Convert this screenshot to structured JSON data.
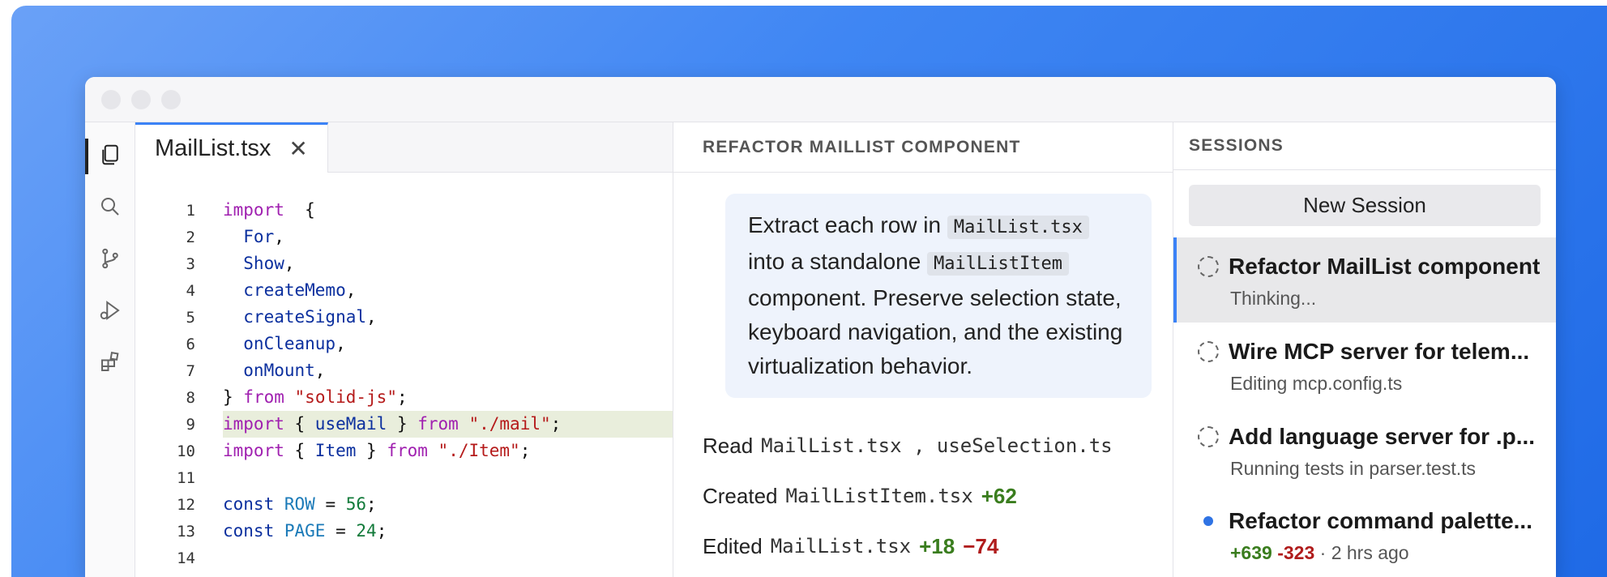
{
  "editor": {
    "tab_label": "MailList.tsx",
    "tab_close": "✕",
    "lines": [
      {
        "n": "1",
        "hl": false,
        "parts": [
          [
            "kw",
            "import"
          ],
          [
            "",
            "  {"
          ]
        ]
      },
      {
        "n": "2",
        "hl": false,
        "parts": [
          [
            "idf",
            "  For"
          ],
          [
            "",
            ","
          ]
        ]
      },
      {
        "n": "3",
        "hl": false,
        "parts": [
          [
            "idf",
            "  Show"
          ],
          [
            "",
            ","
          ]
        ]
      },
      {
        "n": "4",
        "hl": false,
        "parts": [
          [
            "idf",
            "  createMemo"
          ],
          [
            "",
            ","
          ]
        ]
      },
      {
        "n": "5",
        "hl": false,
        "parts": [
          [
            "idf",
            "  createSignal"
          ],
          [
            "",
            ","
          ]
        ]
      },
      {
        "n": "6",
        "hl": false,
        "parts": [
          [
            "idf",
            "  onCleanup"
          ],
          [
            "",
            ","
          ]
        ]
      },
      {
        "n": "7",
        "hl": false,
        "parts": [
          [
            "idf",
            "  onMount"
          ],
          [
            "",
            ","
          ]
        ]
      },
      {
        "n": "8",
        "hl": false,
        "parts": [
          [
            "",
            "} "
          ],
          [
            "kw",
            "from"
          ],
          [
            "",
            " "
          ],
          [
            "str",
            "\"solid-js\""
          ],
          [
            "",
            ";"
          ]
        ]
      },
      {
        "n": "9",
        "hl": true,
        "parts": [
          [
            "kw",
            "import"
          ],
          [
            "",
            " { "
          ],
          [
            "idf",
            "useMail"
          ],
          [
            "",
            " } "
          ],
          [
            "kw",
            "from"
          ],
          [
            "",
            " "
          ],
          [
            "str",
            "\"./mail\""
          ],
          [
            "",
            ";"
          ]
        ]
      },
      {
        "n": "10",
        "hl": false,
        "parts": [
          [
            "kw",
            "import"
          ],
          [
            "",
            " { "
          ],
          [
            "idf",
            "Item"
          ],
          [
            "",
            " } "
          ],
          [
            "kw",
            "from"
          ],
          [
            "",
            " "
          ],
          [
            "str",
            "\"./Item\""
          ],
          [
            "",
            ";"
          ]
        ]
      },
      {
        "n": "11",
        "hl": false,
        "parts": []
      },
      {
        "n": "12",
        "hl": false,
        "parts": [
          [
            "idf",
            "const"
          ],
          [
            "",
            " "
          ],
          [
            "cst",
            "ROW"
          ],
          [
            "",
            " = "
          ],
          [
            "num",
            "56"
          ],
          [
            "",
            ";"
          ]
        ]
      },
      {
        "n": "13",
        "hl": false,
        "parts": [
          [
            "idf",
            "const"
          ],
          [
            "",
            " "
          ],
          [
            "cst",
            "PAGE"
          ],
          [
            "",
            " = "
          ],
          [
            "num",
            "24"
          ],
          [
            "",
            ";"
          ]
        ]
      },
      {
        "n": "14",
        "hl": false,
        "parts": []
      }
    ]
  },
  "chat": {
    "header": "REFACTOR MAILLIST COMPONENT",
    "prompt": {
      "t1": "Extract each row in ",
      "chip1": "MailList.tsx",
      "t2": "into a standalone ",
      "chip2": "MailListItem",
      "t3": "component. Preserve selection state, keyboard navigation, and the existing virtualization behavior."
    },
    "actions": [
      {
        "verb": "Read",
        "files": "MailList.tsx , useSelection.ts",
        "plus": "",
        "minus": ""
      },
      {
        "verb": "Created",
        "files": "MailListItem.tsx",
        "plus": "+62",
        "minus": ""
      },
      {
        "verb": "Edited",
        "files": "MailList.tsx",
        "plus": "+18",
        "minus": "−74"
      }
    ]
  },
  "sessions": {
    "header": "SESSIONS",
    "new_session": "New Session",
    "items": [
      {
        "title": "Refactor MailList component",
        "sub": "Thinking...",
        "status": "running",
        "active": true
      },
      {
        "title": "Wire MCP server for telem...",
        "sub": "Editing mcp.config.ts",
        "status": "running",
        "active": false
      },
      {
        "title": "Add language server for .p...",
        "sub": "Running tests in parser.test.ts",
        "status": "running",
        "active": false
      },
      {
        "title": "Refactor command palette...",
        "sub_plus": "+639",
        "sub_minus": "-323",
        "sub_rest": " · 2 hrs ago",
        "status": "done",
        "active": false
      }
    ]
  },
  "icons": [
    "files-icon",
    "search-icon",
    "source-control-icon",
    "run-debug-icon",
    "extensions-icon"
  ],
  "colors": {
    "accent": "#3b82f6",
    "added": "#3a7d1e",
    "removed": "#b01c1c"
  }
}
